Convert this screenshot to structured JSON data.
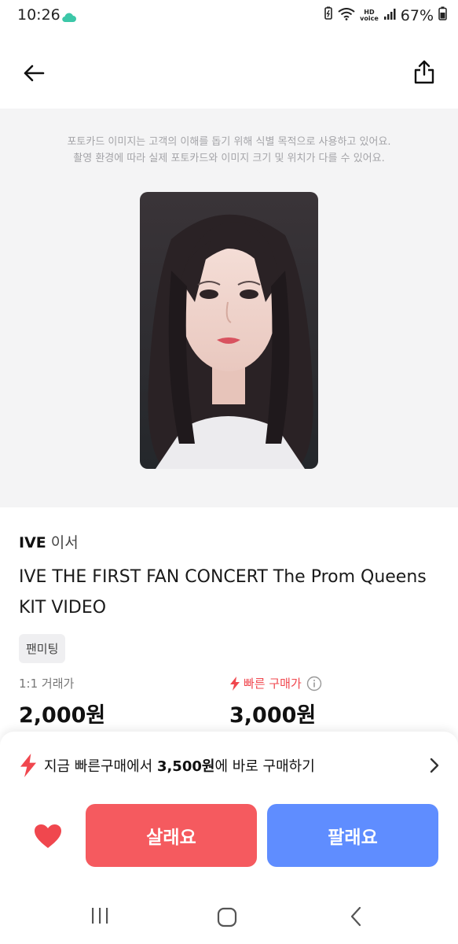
{
  "status_bar": {
    "time": "10:26",
    "battery": "67%"
  },
  "notice": {
    "line1": "포토카드 이미지는 고객의 이해를 돕기 위해 식별 목적으로 사용하고 있어요.",
    "line2": "촬영 환경에 따라 실제 포토카드와 이미지 크기 및 위치가 다를 수 있어요."
  },
  "product": {
    "artist": "IVE",
    "member": "이서",
    "title": "IVE THE FIRST FAN CONCERT The Prom Queens KIT VIDEO",
    "category": "팬미팅"
  },
  "prices": {
    "trade_label": "1:1 거래가",
    "trade_value": "2,000원",
    "fast_label": "빠른 구매가",
    "fast_value": "3,000원"
  },
  "quick_buy": {
    "prefix": "지금 빠른구매에서 ",
    "amount": "3,500원",
    "suffix": "에 바로 구매하기"
  },
  "actions": {
    "buy_label": "살래요",
    "sell_label": "팔래요"
  },
  "colors": {
    "buy": "#f55a5f",
    "sell": "#5f8dff",
    "fast_accent": "#f0474e",
    "like": "#f0474e"
  }
}
